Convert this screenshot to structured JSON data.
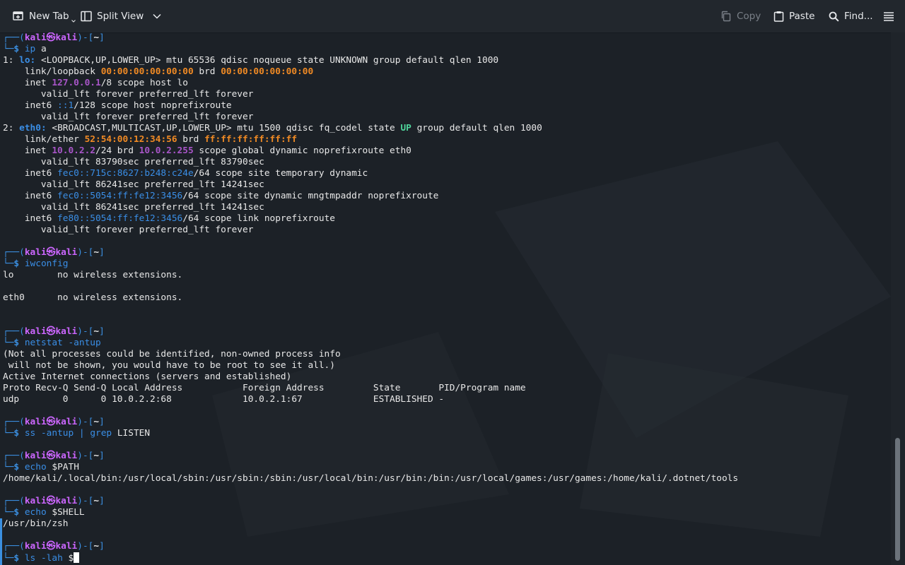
{
  "toolbar": {
    "new_tab": "New Tab",
    "split_view": "Split View",
    "copy": "Copy",
    "paste": "Paste",
    "find": "Find..."
  },
  "colors": {
    "prompt_blue": "#3b8fe0",
    "prompt_user": "#cc66ff",
    "purple": "#a855c8",
    "orange": "#f08a24",
    "blue": "#3a8ee6",
    "green": "#4fd69c",
    "text": "#e8e8e8"
  },
  "prompt": {
    "user": "kali",
    "at": "㉿",
    "host": "kali",
    "cwd": "~",
    "symbol": "$"
  },
  "terminal_lines": [
    {
      "type": "prompt"
    },
    {
      "type": "cmd",
      "parts": [
        {
          "t": "ip",
          "c": "blue"
        },
        {
          "t": " a",
          "c": "text"
        }
      ]
    },
    {
      "type": "out",
      "parts": [
        {
          "t": "1: ",
          "c": "text"
        },
        {
          "t": "lo:",
          "c": "bblue"
        },
        {
          "t": " <LOOPBACK,UP,LOWER_UP> mtu 65536 qdisc noqueue state UNKNOWN group default qlen 1000",
          "c": "text"
        }
      ]
    },
    {
      "type": "out",
      "parts": [
        {
          "t": "    link/loopback ",
          "c": "text"
        },
        {
          "t": "00:00:00:00:00:00",
          "c": "orange"
        },
        {
          "t": " brd ",
          "c": "text"
        },
        {
          "t": "00:00:00:00:00:00",
          "c": "orange"
        }
      ]
    },
    {
      "type": "out",
      "parts": [
        {
          "t": "    inet ",
          "c": "text"
        },
        {
          "t": "127.0.0.1",
          "c": "purple"
        },
        {
          "t": "/8 scope host lo",
          "c": "text"
        }
      ]
    },
    {
      "type": "out",
      "parts": [
        {
          "t": "       valid_lft forever preferred_lft forever",
          "c": "text"
        }
      ]
    },
    {
      "type": "out",
      "parts": [
        {
          "t": "    inet6 ",
          "c": "text"
        },
        {
          "t": "::1",
          "c": "blue"
        },
        {
          "t": "/128 scope host noprefixroute",
          "c": "text"
        }
      ]
    },
    {
      "type": "out",
      "parts": [
        {
          "t": "       valid_lft forever preferred_lft forever",
          "c": "text"
        }
      ]
    },
    {
      "type": "out",
      "parts": [
        {
          "t": "2: ",
          "c": "text"
        },
        {
          "t": "eth0:",
          "c": "bblue"
        },
        {
          "t": " <BROADCAST,MULTICAST,UP,LOWER_UP> mtu 1500 qdisc fq_codel state ",
          "c": "text"
        },
        {
          "t": "UP",
          "c": "green"
        },
        {
          "t": " group default qlen 1000",
          "c": "text"
        }
      ]
    },
    {
      "type": "out",
      "parts": [
        {
          "t": "    link/ether ",
          "c": "text"
        },
        {
          "t": "52:54:00:12:34:56",
          "c": "orange"
        },
        {
          "t": " brd ",
          "c": "text"
        },
        {
          "t": "ff:ff:ff:ff:ff:ff",
          "c": "orange"
        }
      ]
    },
    {
      "type": "out",
      "parts": [
        {
          "t": "    inet ",
          "c": "text"
        },
        {
          "t": "10.0.2.2",
          "c": "purple"
        },
        {
          "t": "/24 brd ",
          "c": "text"
        },
        {
          "t": "10.0.2.255",
          "c": "purple"
        },
        {
          "t": " scope global dynamic noprefixroute eth0",
          "c": "text"
        }
      ]
    },
    {
      "type": "out",
      "parts": [
        {
          "t": "       valid_lft 83790sec preferred_lft 83790sec",
          "c": "text"
        }
      ]
    },
    {
      "type": "out",
      "parts": [
        {
          "t": "    inet6 ",
          "c": "text"
        },
        {
          "t": "fec0::715c:8627:b248:c24e",
          "c": "blue"
        },
        {
          "t": "/64 scope site temporary dynamic",
          "c": "text"
        }
      ]
    },
    {
      "type": "out",
      "parts": [
        {
          "t": "       valid_lft 86241sec preferred_lft 14241sec",
          "c": "text"
        }
      ]
    },
    {
      "type": "out",
      "parts": [
        {
          "t": "    inet6 ",
          "c": "text"
        },
        {
          "t": "fec0::5054:ff:fe12:3456",
          "c": "blue"
        },
        {
          "t": "/64 scope site dynamic mngtmpaddr noprefixroute",
          "c": "text"
        }
      ]
    },
    {
      "type": "out",
      "parts": [
        {
          "t": "       valid_lft 86241sec preferred_lft 14241sec",
          "c": "text"
        }
      ]
    },
    {
      "type": "out",
      "parts": [
        {
          "t": "    inet6 ",
          "c": "text"
        },
        {
          "t": "fe80::5054:ff:fe12:3456",
          "c": "blue"
        },
        {
          "t": "/64 scope link noprefixroute",
          "c": "text"
        }
      ]
    },
    {
      "type": "out",
      "parts": [
        {
          "t": "       valid_lft forever preferred_lft forever",
          "c": "text"
        }
      ]
    },
    {
      "type": "blank"
    },
    {
      "type": "prompt"
    },
    {
      "type": "cmd",
      "parts": [
        {
          "t": "iwconfig",
          "c": "blue"
        }
      ]
    },
    {
      "type": "out",
      "parts": [
        {
          "t": "lo        no wireless extensions.",
          "c": "text"
        }
      ]
    },
    {
      "type": "blank"
    },
    {
      "type": "out",
      "parts": [
        {
          "t": "eth0      no wireless extensions.",
          "c": "text"
        }
      ]
    },
    {
      "type": "blank"
    },
    {
      "type": "blank"
    },
    {
      "type": "prompt"
    },
    {
      "type": "cmd",
      "parts": [
        {
          "t": "netstat -antup",
          "c": "blue"
        }
      ]
    },
    {
      "type": "out",
      "parts": [
        {
          "t": "(Not all processes could be identified, non-owned process info",
          "c": "text"
        }
      ]
    },
    {
      "type": "out",
      "parts": [
        {
          "t": " will not be shown, you would have to be root to see it all.)",
          "c": "text"
        }
      ]
    },
    {
      "type": "out",
      "parts": [
        {
          "t": "Active Internet connections (servers and established)",
          "c": "text"
        }
      ]
    },
    {
      "type": "out",
      "parts": [
        {
          "t": "Proto Recv-Q Send-Q Local Address           Foreign Address         State       PID/Program name",
          "c": "text"
        }
      ]
    },
    {
      "type": "out",
      "parts": [
        {
          "t": "udp        0      0 10.0.2.2:68             10.0.2.1:67             ESTABLISHED -",
          "c": "text"
        }
      ]
    },
    {
      "type": "blank"
    },
    {
      "type": "prompt"
    },
    {
      "type": "cmd",
      "parts": [
        {
          "t": "ss -antup ",
          "c": "blue"
        },
        {
          "t": "|",
          "c": "blue"
        },
        {
          "t": " grep",
          "c": "blue"
        },
        {
          "t": " LISTEN",
          "c": "text"
        }
      ]
    },
    {
      "type": "blank"
    },
    {
      "type": "prompt"
    },
    {
      "type": "cmd",
      "parts": [
        {
          "t": "echo",
          "c": "blue"
        },
        {
          "t": " $PATH",
          "c": "text"
        }
      ]
    },
    {
      "type": "out",
      "parts": [
        {
          "t": "/home/kali/.local/bin:/usr/local/sbin:/usr/sbin:/sbin:/usr/local/bin:/usr/bin:/bin:/usr/local/games:/usr/games:/home/kali/.dotnet/tools",
          "c": "text"
        }
      ]
    },
    {
      "type": "blank"
    },
    {
      "type": "prompt"
    },
    {
      "type": "cmd",
      "parts": [
        {
          "t": "echo",
          "c": "blue"
        },
        {
          "t": " $SHELL",
          "c": "text"
        }
      ]
    },
    {
      "type": "out",
      "parts": [
        {
          "t": "/usr/bin/zsh",
          "c": "text"
        }
      ]
    },
    {
      "type": "blank"
    },
    {
      "type": "prompt"
    },
    {
      "type": "cmd",
      "cursor": true,
      "parts": [
        {
          "t": "ls -lah",
          "c": "blue"
        },
        {
          "t": " $",
          "c": "text"
        }
      ]
    }
  ]
}
